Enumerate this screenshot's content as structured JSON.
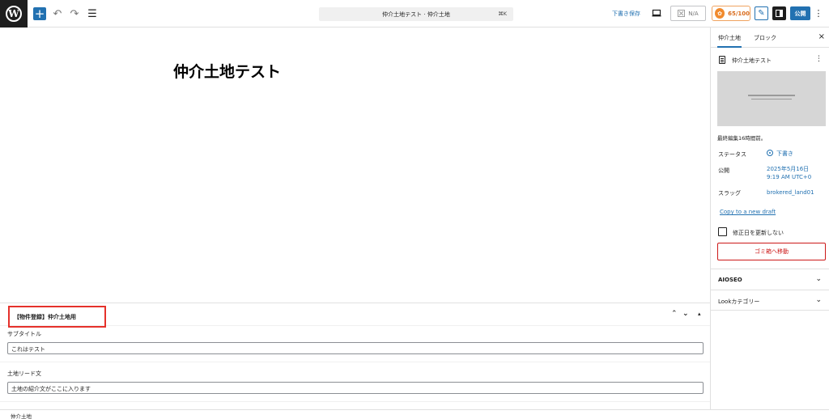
{
  "topbar": {
    "wp_logo": "W",
    "add_label": "+",
    "undo_icon": "↶",
    "redo_icon": "↷",
    "outline_icon": "☰",
    "command_title": "仲介土地テスト · 仲介土地",
    "command_shortcut": "⌘K",
    "save_draft": "下書き保存",
    "na_label": "N/A",
    "seo_score": "65/100",
    "publish": "公開",
    "more": "⋮"
  },
  "editor": {
    "post_title": "仲介土地テスト"
  },
  "metabox": {
    "title": "【物件登録】仲介土地用",
    "controls": [
      "⌃",
      "⌄",
      "▴"
    ],
    "fields": [
      {
        "label": "サブタイトル",
        "value": "これはテスト"
      },
      {
        "label": "土地リード文",
        "value": "土地の紹介文がここに入ります"
      }
    ]
  },
  "footer": {
    "breadcrumb": "仲介土地"
  },
  "sidebar": {
    "tabs": [
      "仲介土地",
      "ブロック"
    ],
    "close": "×",
    "post_name": "仲介土地テスト",
    "kebab": "⋮",
    "last_modified": "最終編集16時間前。",
    "rows": [
      {
        "label": "ステータス",
        "value": "下書き"
      },
      {
        "label": "公開",
        "value": "2025年5月16日",
        "value2": "9:19 AM UTC+0"
      },
      {
        "label": "スラッグ",
        "value": "brokered_land01"
      }
    ],
    "copy_link": "Copy to a new draft",
    "no_update_label": "修正日を更新しない",
    "trash": "ゴミ箱へ移動",
    "sections": [
      {
        "title": "AIOSEO",
        "chevron": "⌄"
      },
      {
        "title": "Lookカテゴリー",
        "chevron": "⌄"
      }
    ]
  },
  "colors": {
    "accent": "#2271b1",
    "highlight_border": "#e5312b",
    "danger": "#cc1818",
    "score": "#f18a2d"
  }
}
